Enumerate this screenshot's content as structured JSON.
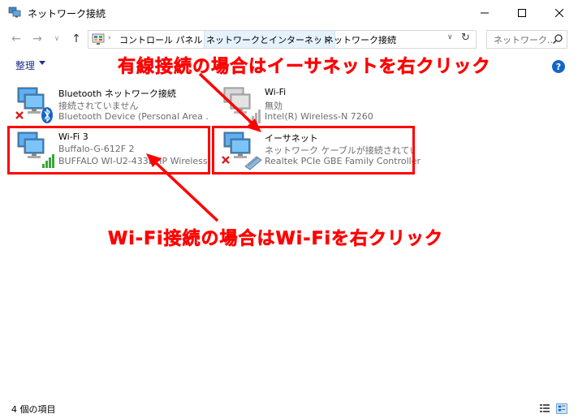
{
  "window": {
    "title": "ネットワーク接続"
  },
  "address_bar": {
    "breadcrumbs": [
      "コントロール パネル",
      "ネットワークとインターネット",
      "ネットワーク接続"
    ]
  },
  "search": {
    "placeholder": "ネットワーク..."
  },
  "command_bar": {
    "organize_label": "整理"
  },
  "connections": [
    {
      "name": "Bluetooth ネットワーク接続",
      "status": "接続されていません",
      "device": "Bluetooth Device (Personal Area ...",
      "icon": "bluetooth-network-icon",
      "disconnected": true
    },
    {
      "name": "Wi-Fi",
      "status": "無効",
      "device": "Intel(R) Wireless-N 7260",
      "icon": "wifi-disabled-network-icon",
      "disconnected": false
    },
    {
      "name": "Wi-Fi 3",
      "status": "Buffalo-G-612F 2",
      "device": "BUFFALO WI-U2-433DHP Wireless ...",
      "icon": "wifi-signal-network-icon",
      "disconnected": false
    },
    {
      "name": "イーサネット",
      "status": "ネットワーク ケーブルが接続されていま...",
      "device": "Realtek PCIe GBE Family Controller",
      "icon": "ethernet-network-icon",
      "disconnected": true
    }
  ],
  "annotations": {
    "wired": "有線接続の場合はイーサネットを右クリック",
    "wifi": "Wi-Fi接続の場合はWi-Fiを右クリック",
    "color": "#ff0000"
  },
  "status_bar": {
    "item_count": "4 個の項目"
  },
  "colors": {
    "accent": "#1565c8",
    "link_text": "#1e3287",
    "secondary_text": "#6d6d6d",
    "annotation": "#ff0000"
  }
}
